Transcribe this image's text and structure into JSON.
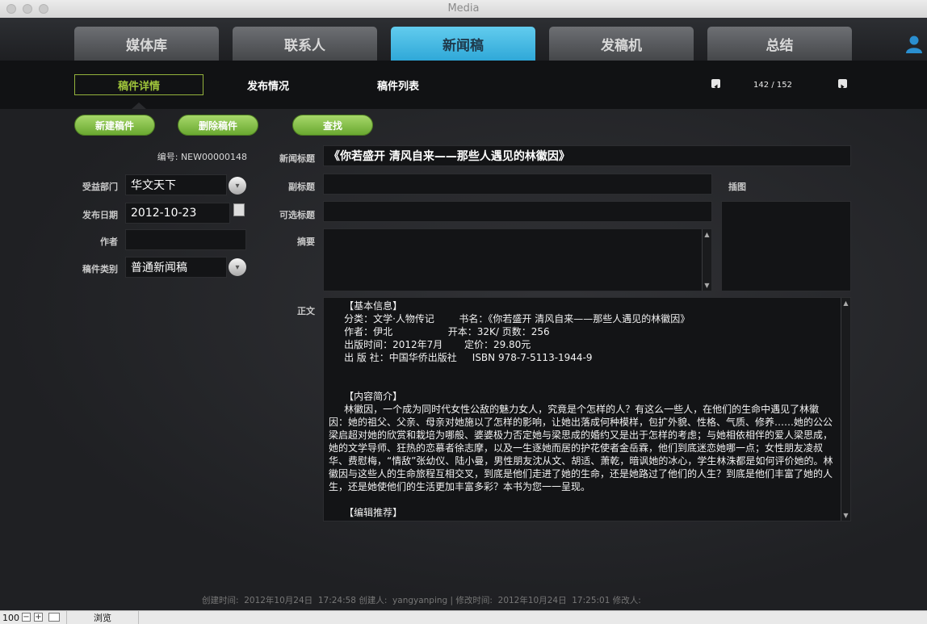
{
  "window": {
    "title": "Media"
  },
  "tabs": [
    {
      "label": "媒体库"
    },
    {
      "label": "联系人"
    },
    {
      "label": "新闻稿"
    },
    {
      "label": "发稿机"
    },
    {
      "label": "总结"
    }
  ],
  "subnav": {
    "items": [
      {
        "label": "稿件详情"
      },
      {
        "label": "发布情况"
      },
      {
        "label": "稿件列表"
      }
    ],
    "pager": "142 / 152"
  },
  "actions": {
    "new": "新建稿件",
    "delete": "删除稿件",
    "search": "查找"
  },
  "left": {
    "id_text": "编号: NEW00000148",
    "dept_label": "受益部门",
    "dept_value": "华文天下",
    "date_label": "发布日期",
    "date_value": "2012-10-23",
    "author_label": "作者",
    "author_value": "",
    "type_label": "稿件类别",
    "type_value": "普通新闻稿"
  },
  "form": {
    "title_label": "新闻标题",
    "title_value": "《你若盛开 清风自来——那些人遇见的林徽因》",
    "subtitle_label": "副标题",
    "subtitle_value": "",
    "alt_title_label": "可选标题",
    "alt_title_value": "",
    "abstract_label": "摘要",
    "abstract_value": "",
    "illustration_label": "插图",
    "body_label": "正文",
    "body_text": "     【基本信息】\n     分类：文学·人物传记        书名：《你若盛开 清风自来——那些人遇见的林徽因》\n     作者：伊北                  开本：32K/ 页数：256\n     出版时间：2012年7月       定价：29.80元\n     出 版 社：中国华侨出版社     ISBN 978-7-5113-1944-9\n\n\n     【内容简介】\n     林徽因，一个成为同时代女性公敌的魅力女人，究竟是个怎样的人？有这么一些人，在他们的生命中遇见了林徽因：她的祖父、父亲、母亲对她施以了怎样的影响，让她出落成何种模样，包扩外貌、性格、气质、修养……她的公公梁启超对她的欣赏和栽培为哪般、婆婆极力否定她与梁思成的婚约又是出于怎样的考虑；与她相依相伴的爱人梁思成，她的文学导师、狂热的恋慕者徐志摩，以及一生逐她而居的护花使者金岳霖，他们到底迷恋她哪一点；女性朋友凌叔华、费慰梅，“情敌”张幼仪、陆小曼，男性朋友沈从文、胡适、萧乾，暗讽她的冰心，学生林洙都是如何评价她的。林徽因与这些人的生命旅程互相交叉，到底是他们走进了她的生命，还是她路过了他们的人生？到底是他们丰富了她的人生，还是她使他们的生活更加丰富多彩？本书为您一一呈现。\n\n     【编辑推荐】"
  },
  "footer": "创建时间:  2012年10月24日  17:24:58 创建人:  yangyanping | 修改时间:  2012年10月24日  17:25:01 修改人:",
  "statusbar": {
    "zoom": "100",
    "mode": "浏览"
  }
}
